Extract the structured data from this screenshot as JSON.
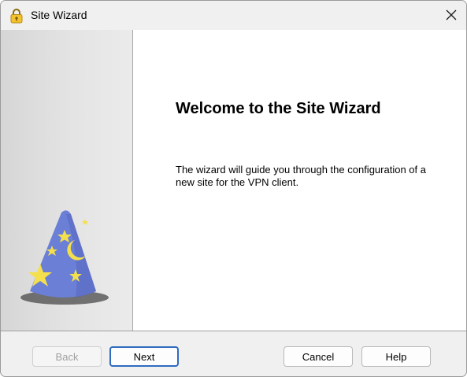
{
  "window": {
    "title": "Site Wizard",
    "title_icon": "padlock-icon",
    "close_icon": "close-icon"
  },
  "side_panel": {
    "illustration": "wizard-hat-icon"
  },
  "content": {
    "heading": "Welcome to the Site Wizard",
    "description": "The wizard will guide you through the configuration of a new site for the VPN client."
  },
  "buttons": {
    "back": "Back",
    "next": "Next",
    "cancel": "Cancel",
    "help": "Help"
  },
  "colors": {
    "hat_body": "#6b7fd6",
    "hat_stars": "#f4e04d",
    "default_button_border": "#2f6bbf"
  }
}
